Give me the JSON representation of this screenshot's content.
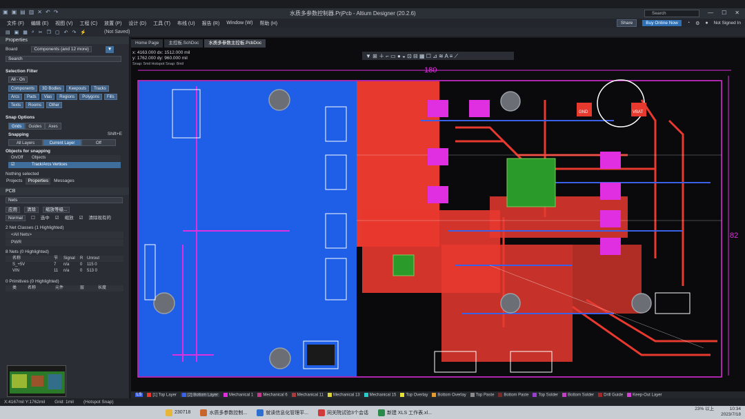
{
  "window": {
    "title": "水质多参数控制器.PrjPcb - Altium Designer (20.2.6)",
    "search_placeholder": "Search"
  },
  "menu": {
    "items": [
      "文件 (F)",
      "编辑 (E)",
      "视图 (V)",
      "工程 (C)",
      "放置 (P)",
      "设计 (D)",
      "工具 (T)",
      "布线 (U)",
      "报告 (R)",
      "Window (W)",
      "帮助 (H)"
    ],
    "share": "Share",
    "buy": "Buy Online Now",
    "signed": "Not Signed In"
  },
  "toolbar": {
    "saved": "(Not Saved)"
  },
  "doc_tabs": [
    "Home Page",
    "主控板.SchDoc",
    "水质多参数主控板.PcbDoc"
  ],
  "coords": {
    "line1": "x: 4163.000  dx: 1512.000 mil",
    "line2": "y: 1762.000  dy: 960.000 mil",
    "line3": "Snap: 5mil Hotspot Snap: 8mil"
  },
  "properties": {
    "title": "Properties",
    "board_label": "Board",
    "components": "Components (and 12 more)",
    "search": "Search",
    "selection_filter": "Selection Filter",
    "all_on": "All - On",
    "filters": [
      "Components",
      "3D Bodies",
      "Keepouts",
      "Tracks",
      "Arcs",
      "Pads",
      "Vias",
      "Regions",
      "Polygons",
      "Fills",
      "Texts",
      "Rooms",
      "Other"
    ],
    "snap_options": "Snap Options",
    "snap_buttons": [
      "Grids",
      "Guides",
      "Axes"
    ],
    "snapping": "Snapping",
    "snapping_hint": "Shift+E",
    "snap_modes": [
      "All Layers",
      "Current Layer",
      "Off"
    ],
    "objects_for_snapping": "Objects for snapping",
    "onoff": "On/Off",
    "objects": "Objects",
    "obj_item": "Track/Arcs Vertices",
    "nothing_selected": "Nothing selected"
  },
  "bottom_panel": {
    "tabs": [
      "Projects",
      "Properties",
      "Messages"
    ],
    "title": "PCB",
    "nets": "Nets",
    "apply": "应用",
    "clear": "清除",
    "zoom": "缩放等级...",
    "normal": "Normal",
    "check_select": "选中",
    "check_zoom": "缩放",
    "check_clear": "清除现有的",
    "net_classes": "2 Net Classes (1 Highlighted)",
    "all_nets": "<All Nets>",
    "pwr": "PWR",
    "nets_count": "8 Nets (0 Highlighted)",
    "net_cols": [
      "名称",
      "节",
      "Signal",
      "R",
      "Unrout"
    ],
    "net_rows": [
      [
        "S_+5V",
        "7",
        "n/a",
        "0",
        "115 0"
      ],
      [
        "VIN",
        "11",
        "n/a",
        "0",
        "513 0"
      ]
    ],
    "primitives": "0 Primitives (0 Highlighted)",
    "prim_cols": [
      "类",
      "名称",
      "元件",
      "层",
      "长度"
    ]
  },
  "layers": [
    {
      "name": "[1] Top Layer",
      "color": "#e8392f"
    },
    {
      "name": "[2] Bottom Layer",
      "color": "#3a62e8"
    },
    {
      "name": "Mechanical 1",
      "color": "#e02fe0"
    },
    {
      "name": "Mechanical 6",
      "color": "#c23b8a"
    },
    {
      "name": "Mechanical 11",
      "color": "#a83a3a"
    },
    {
      "name": "Mechanical 13",
      "color": "#d9d23a"
    },
    {
      "name": "Mechanical 15",
      "color": "#2ecbcb"
    },
    {
      "name": "Top Overlay",
      "color": "#e6e03a"
    },
    {
      "name": "Bottom Overlay",
      "color": "#e29c2e"
    },
    {
      "name": "Top Paste",
      "color": "#8a8a8a"
    },
    {
      "name": "Bottom Paste",
      "color": "#7a2a2a"
    },
    {
      "name": "Top Solder",
      "color": "#9b3fd0"
    },
    {
      "name": "Bottom Solder",
      "color": "#c43fc4"
    },
    {
      "name": "Drill Guide",
      "color": "#a02828"
    },
    {
      "name": "Keep-Out Layer",
      "color": "#d63fd6"
    }
  ],
  "status": {
    "xy": "X:4167mil Y:1762mil",
    "grid": "Grid: 1mil",
    "snap": "(Hotspot Snap)"
  },
  "dimensions": {
    "top": "180",
    "right": "82"
  },
  "pcb_labels": {
    "gnd": "GND",
    "vbat": "VBAT"
  },
  "taskbar": {
    "items": [
      "230718",
      "水质多参数控制...",
      "就读信息化管理平...",
      "同关院试验3个会话",
      "新建 XLS 工作表.xl..."
    ],
    "weather": "23% 以上",
    "time": "10:34",
    "date": "2023/7/18"
  }
}
